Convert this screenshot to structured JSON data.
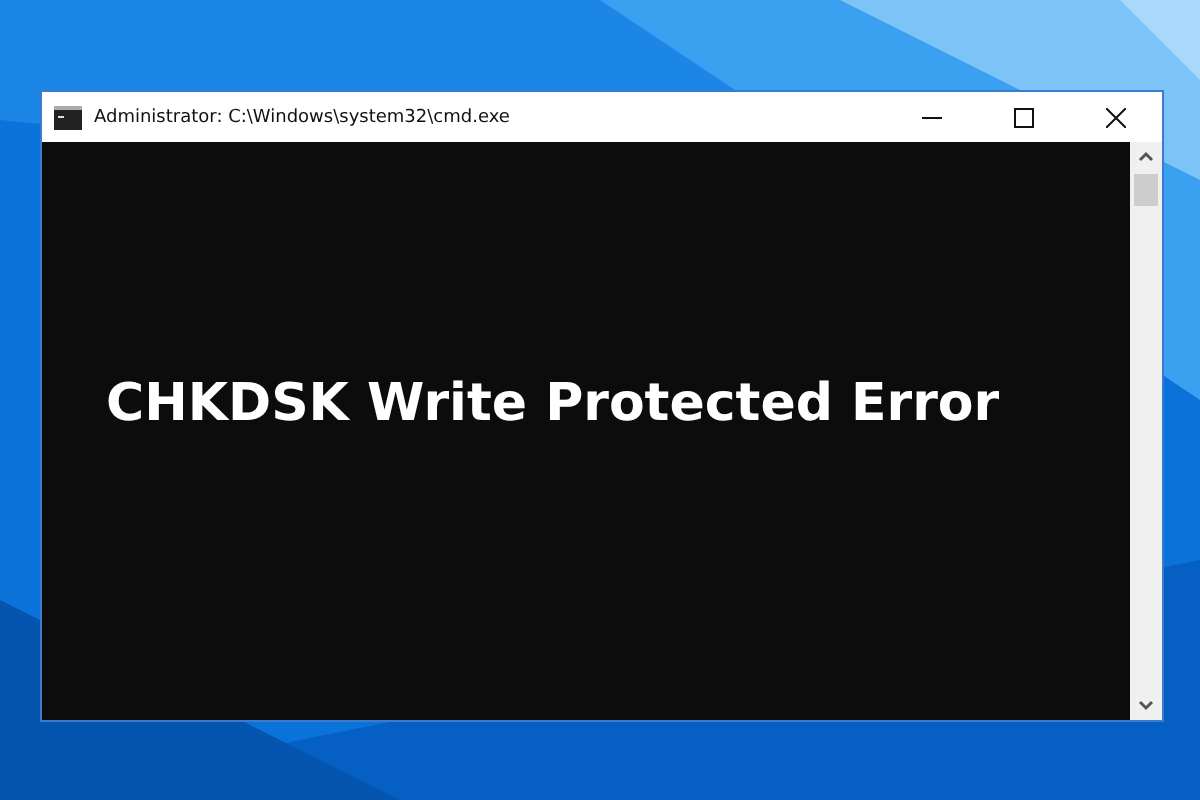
{
  "window": {
    "title": "Administrator: C:\\Windows\\system32\\cmd.exe"
  },
  "console": {
    "headline": "CHKDSK Write Protected Error"
  }
}
